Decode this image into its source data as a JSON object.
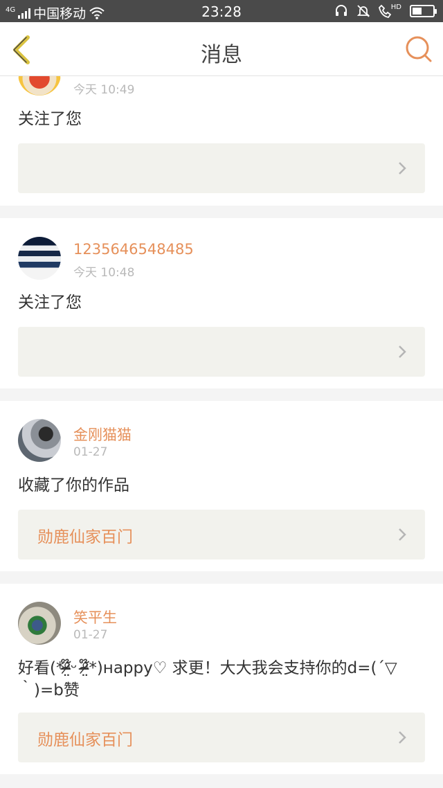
{
  "status_bar": {
    "network": "4G",
    "carrier": "中国移动",
    "time": "23:28",
    "hd": "HD",
    "battery_level": 0.45,
    "icons": [
      "wifi-icon",
      "headset-icon",
      "bell-mute-icon",
      "call-hd-icon",
      "battery-icon"
    ]
  },
  "nav": {
    "back_icon": "chevron-left-icon",
    "title": "消息",
    "search_icon": "search-icon",
    "accent_color": "#e6905a",
    "back_color": "#d9c240"
  },
  "messages": [
    {
      "username": "",
      "time": "今天 10:49",
      "action": "关注了您",
      "work": ""
    },
    {
      "username": "1235646548485",
      "time": "今天 10:48",
      "action": "关注了您",
      "work": ""
    },
    {
      "username": "金刚猫猫",
      "time": "01-27",
      "action": "收藏了你的作品",
      "work": "勋鹿仙家百门"
    },
    {
      "username": "笑平生",
      "time": "01-27",
      "action": "好看(*ᵒ̴̶̷໊̤ᵕ ᵒ̴̶̷໊̤*)нappy♡ 求更！大大我会支持你的d=(´▽｀)=b赞",
      "work": "勋鹿仙家百门"
    }
  ]
}
